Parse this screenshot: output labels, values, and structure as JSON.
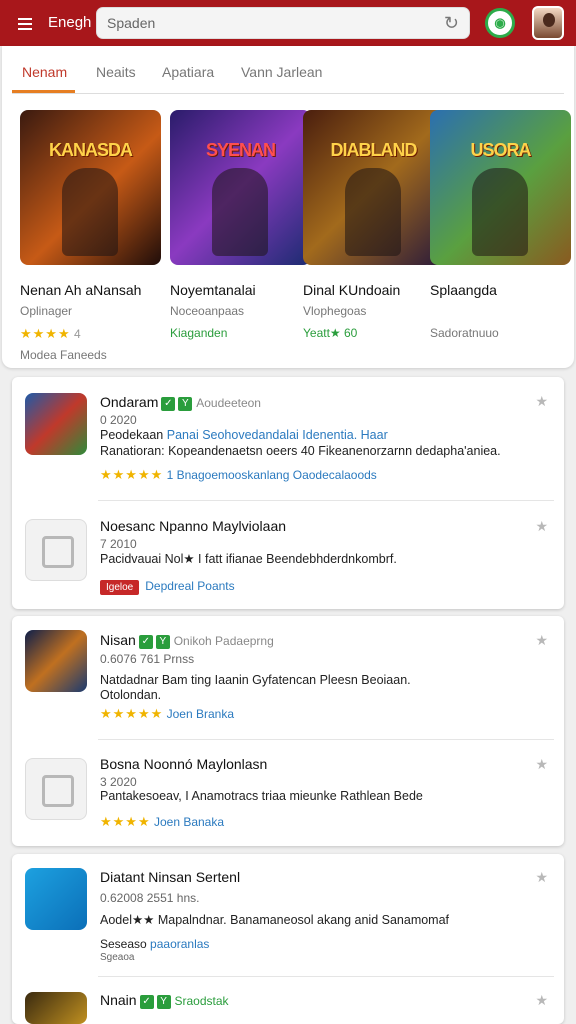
{
  "header": {
    "brand": "Enegh",
    "search_placeholder": "Spaden",
    "refresh_icon": "refresh-icon",
    "colors": {
      "bar": "#a8171b",
      "accent": "#e67e22",
      "link": "#2b7abf"
    }
  },
  "tabs": [
    "Nenam",
    "Neaits",
    "Apatiara",
    "Vann Jarlean"
  ],
  "featured": [
    {
      "logo": "KANASDA",
      "title": "Nenan Ah aNansah",
      "subtitle": "Oplinager",
      "rating": "★★★★",
      "rating_note": "4",
      "footer": "Modea Faneeds"
    },
    {
      "logo": "SYENAN",
      "title": "Noyemtanalai",
      "subtitle": "Noceoanpaas",
      "rating": "",
      "rating_note": "Kiaganden",
      "footer": ""
    },
    {
      "logo": "DIABLAND",
      "title": "Dinal KUndoain",
      "subtitle": "Vlophegoas",
      "rating": "",
      "rating_note": "Yeatt★ 60",
      "footer": ""
    },
    {
      "logo": "USORA",
      "title": "Splaangda",
      "subtitle": "",
      "rating": "",
      "rating_note": "Sadoratnuuo",
      "footer": ""
    }
  ],
  "list": [
    {
      "title": "Ondaram",
      "subtitle_tag": "Aoudeeteon",
      "meta": "0 2020",
      "desc1_prefix": "Peodekaan",
      "desc1_link": "Panai Seohovedandalai Idenentia. Haar",
      "desc2": "Ranatioran: Kopeandenaetsn oeers 40 Fikeanenorzarnn dedapha'aniea.",
      "rating": "★★★★★",
      "foot_link1": "1 Bnagoemooskanlang",
      "foot_link2": "Oaodecalaoods"
    },
    {
      "title": "Noesanc",
      "title2": "Npanno Maylviolaan",
      "meta": "7 2010",
      "desc1": "Pacidvauai Nol★ I fatt ifianae Beendebhderdnkombrf.",
      "tag": "Igeloe",
      "foot_link1": "Depdreal Poants"
    },
    {
      "title": "Nisan",
      "subtitle_tag": "Onikoh Padaeprng",
      "meta": "0.6076",
      "meta2": "761 Prnss",
      "desc1": "Natdadnar Bam ting Iaanin Gyfatencan Pleesn Beoiaan.",
      "desc2": "Otolondan.",
      "rating": "★★★★★",
      "foot_link1": "Joen Branka"
    },
    {
      "title": "Bosna",
      "title2": "Noonnó Maylonlasn",
      "meta": "3 2020",
      "desc1": "Pantakesoeav, I Anamotracs triaa mieunke Rathlean Bede",
      "rating": "★★★★",
      "foot_link1": "Joen Banaka"
    },
    {
      "title": "Diatant",
      "title2": "Ninsan Sertenl",
      "meta": "0.62008",
      "meta2": "2551 hns.",
      "desc1": "Aodel★★ Mapalndnar. Banamaneosol akang anid Sanamomaf",
      "foot_text": "Seseaso",
      "foot_link1": "paaoranlas",
      "foot_sub": "Sgeaoa"
    },
    {
      "title": "Nnain",
      "subtitle_tag": "Sraodstak"
    }
  ]
}
